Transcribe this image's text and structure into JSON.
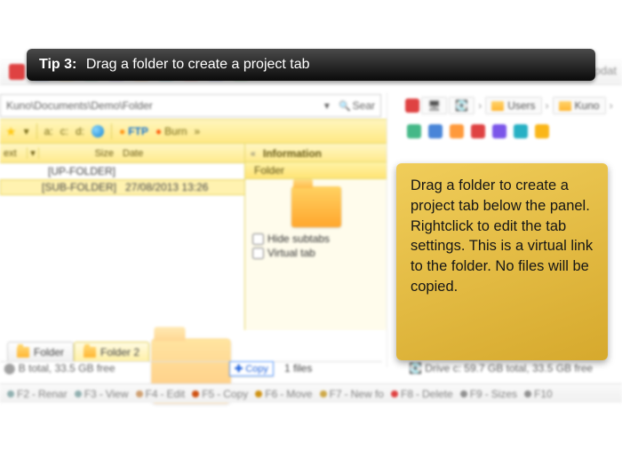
{
  "tip": {
    "prefix": "Tip 3:",
    "title": "Drag a folder to create a project tab",
    "body": "Drag a folder to create a project tab below the panel. Rightclick to edit the tab settings. This is a virtual link to the folder. No files will be copied."
  },
  "top_right_label": "Updat",
  "left": {
    "address": "Kuno\\Documents\\Demo\\Folder",
    "search_label": "Sear",
    "toolbar": {
      "ftp": "FTP",
      "burn": "Burn"
    },
    "columns": {
      "ext": "ext",
      "size": "Size",
      "date": "Date"
    },
    "rows": [
      {
        "name": "[UP-FOLDER]",
        "date": ""
      },
      {
        "name": "[SUB-FOLDER]",
        "date": "27/08/2013 13:26"
      }
    ],
    "info": {
      "heading": "Information",
      "type_label": "Folder",
      "hide_subtabs": "Hide subtabs",
      "virtual_tab": "Virtual tab"
    },
    "tabs": [
      {
        "label": "Folder",
        "active": false
      },
      {
        "label": "Folder 2",
        "active": true
      }
    ],
    "drag": {
      "badge": "Copy",
      "count_label": "1 files"
    },
    "status": "B total, 33.5 GB free"
  },
  "right": {
    "path_segments": [
      "Users",
      "Kuno"
    ],
    "status": "Drive c: 59.7 GB total, 33.5 GB free"
  },
  "fnkeys": [
    {
      "key": "F2",
      "label": "Renar",
      "color": "#8aa"
    },
    {
      "key": "F3",
      "label": "View",
      "color": "#8aa"
    },
    {
      "key": "F4",
      "label": "Edit",
      "color": "#c96"
    },
    {
      "key": "F5",
      "label": "Copy",
      "color": "#c40"
    },
    {
      "key": "F6",
      "label": "Move",
      "color": "#cc8a00"
    },
    {
      "key": "F7",
      "label": "New fo",
      "color": "#caa23a"
    },
    {
      "key": "F8",
      "label": "Delete",
      "color": "#d33"
    },
    {
      "key": "F9",
      "label": "Sizes",
      "color": "#888"
    },
    {
      "key": "F10",
      "label": "",
      "color": "#888"
    }
  ]
}
